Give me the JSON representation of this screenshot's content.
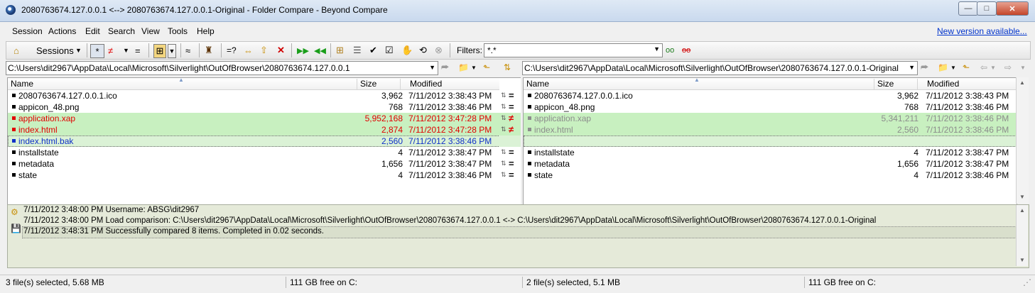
{
  "window": {
    "title": "2080763674.127.0.0.1 <--> 2080763674.127.0.0.1-Original - Folder Compare - Beyond Compare",
    "controls": {
      "minimize": "—",
      "maximize": "□",
      "close": "✕"
    }
  },
  "menu": {
    "items": [
      "Session",
      "Actions",
      "Edit",
      "Search",
      "View",
      "Tools",
      "Help"
    ],
    "new_version": "New version available..."
  },
  "toolbar": {
    "sessions_label": "Sessions",
    "filters_label": "Filters:",
    "filters_value": "*.*",
    "icons": [
      "home-icon",
      "show-all-icon",
      "show-differences-icon",
      "show-same-icon",
      "folder-structure-icon",
      "rules-icon",
      "stop-icon",
      "compare-contents-icon",
      "swap-sides-icon",
      "up-level-icon",
      "delete-icon",
      "copy-right-icon",
      "copy-left-icon",
      "expand-icon",
      "collapse-icon",
      "select-all-icon",
      "select-changed-icon",
      "touch-icon",
      "refresh-icon",
      "cancel-icon",
      "filter-show-icon",
      "filter-hide-icon"
    ]
  },
  "left": {
    "path": "C:\\Users\\dit2967\\AppData\\Local\\Microsoft\\Silverlight\\OutOfBrowser\\2080763674.127.0.0.1",
    "columns": [
      "Name",
      "Size",
      "Modified"
    ],
    "rows": [
      {
        "name": "2080763674.127.0.0.1.ico",
        "size": "3,962",
        "modified": "7/11/2012 3:38:43 PM",
        "state": "same"
      },
      {
        "name": "appicon_48.png",
        "size": "768",
        "modified": "7/11/2012 3:38:46 PM",
        "state": "same"
      },
      {
        "name": "application.xap",
        "size": "5,952,168",
        "modified": "7/11/2012 3:47:28 PM",
        "state": "diff"
      },
      {
        "name": "index.html",
        "size": "2,874",
        "modified": "7/11/2012 3:47:28 PM",
        "state": "diff"
      },
      {
        "name": "index.html.bak",
        "size": "2,560",
        "modified": "7/11/2012 3:38:46 PM",
        "state": "orphan"
      },
      {
        "name": "installstate",
        "size": "4",
        "modified": "7/11/2012 3:38:47 PM",
        "state": "same"
      },
      {
        "name": "metadata",
        "size": "1,656",
        "modified": "7/11/2012 3:38:47 PM",
        "state": "same"
      },
      {
        "name": "state",
        "size": "4",
        "modified": "7/11/2012 3:38:46 PM",
        "state": "same"
      }
    ],
    "status_selected": "3 file(s) selected, 5.68 MB",
    "status_free": "111 GB free on C:"
  },
  "right": {
    "path": "C:\\Users\\dit2967\\AppData\\Local\\Microsoft\\Silverlight\\OutOfBrowser\\2080763674.127.0.0.1-Original",
    "columns": [
      "Name",
      "Size",
      "Modified"
    ],
    "rows": [
      {
        "name": "2080763674.127.0.0.1.ico",
        "size": "3,962",
        "modified": "7/11/2012 3:38:43 PM",
        "state": "same"
      },
      {
        "name": "appicon_48.png",
        "size": "768",
        "modified": "7/11/2012 3:38:46 PM",
        "state": "same"
      },
      {
        "name": "application.xap",
        "size": "5,341,211",
        "modified": "7/11/2012 3:38:46 PM",
        "state": "older"
      },
      {
        "name": "index.html",
        "size": "2,560",
        "modified": "7/11/2012 3:38:46 PM",
        "state": "older"
      },
      {
        "name": "",
        "size": "",
        "modified": "",
        "state": "orphan"
      },
      {
        "name": "installstate",
        "size": "4",
        "modified": "7/11/2012 3:38:47 PM",
        "state": "same"
      },
      {
        "name": "metadata",
        "size": "1,656",
        "modified": "7/11/2012 3:38:47 PM",
        "state": "same"
      },
      {
        "name": "state",
        "size": "4",
        "modified": "7/11/2012 3:38:46 PM",
        "state": "same"
      }
    ],
    "status_selected": "2 file(s) selected, 5.1 MB",
    "status_free": "111 GB free on C:"
  },
  "middle": {
    "symbols": [
      "=",
      "=",
      "≠",
      "≠",
      "",
      "=",
      "=",
      "="
    ]
  },
  "log": {
    "lines": [
      "7/11/2012 3:48:00 PM  Username: ABSG\\dit2967",
      "7/11/2012 3:48:00 PM  Load comparison: C:\\Users\\dit2967\\AppData\\Local\\Microsoft\\Silverlight\\OutOfBrowser\\2080763674.127.0.0.1 <-> C:\\Users\\dit2967\\AppData\\Local\\Microsoft\\Silverlight\\OutOfBrowser\\2080763674.127.0.0.1-Original",
      "7/11/2012 3:48:31 PM  Successfully compared 8 items.  Completed in 0.02 seconds."
    ]
  },
  "colors": {
    "diff_text": "#e10000",
    "diff_bg": "#c8f0c0",
    "older_text": "#8c8c8c",
    "orphan_text": "#1030c8",
    "log_bg": "#e5ead9"
  }
}
